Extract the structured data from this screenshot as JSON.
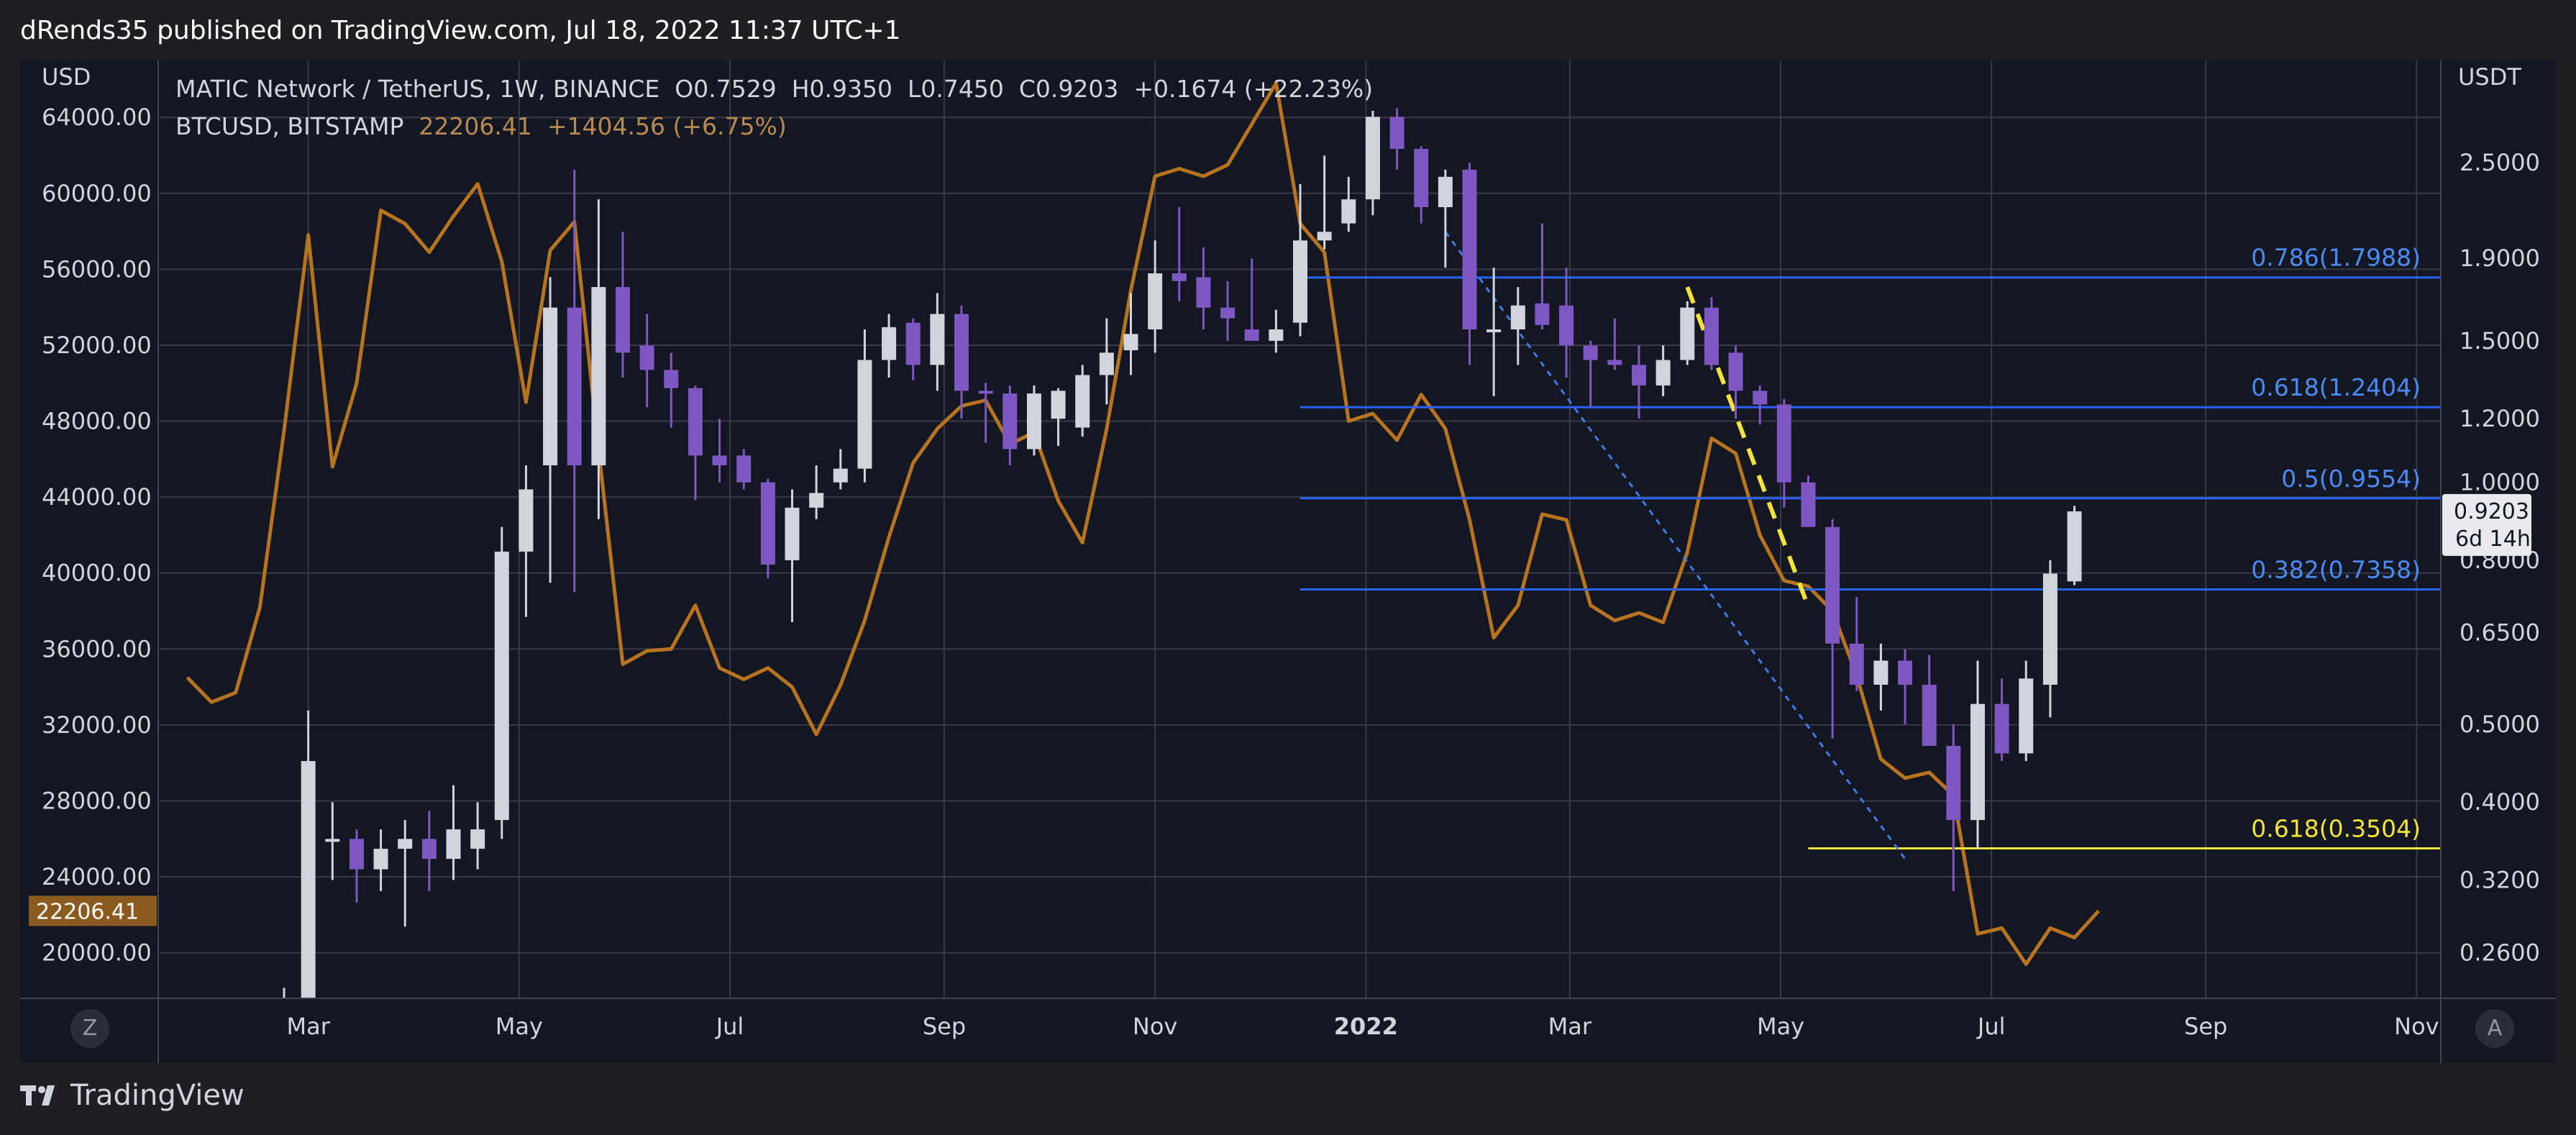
{
  "header": {
    "published_line": "dRends35 published on TradingView.com, Jul 18, 2022 11:37 UTC+1"
  },
  "footer": {
    "brand": "TradingView"
  },
  "buttons": {
    "left": "Z",
    "right": "A"
  },
  "colors": {
    "background": "#131722",
    "frame": "#1f1f23",
    "grid": "#363a45",
    "candle_up": "#d1d4dc",
    "candle_down": "#7e57c2",
    "btc_line": "#b8731f",
    "fib_blue": "#2962ff",
    "fib_blue_label": "#4c8bf5",
    "fib_yellow": "#f5e33b",
    "trend_blue": "#3d7be8",
    "trend_yellow": "#f5e33b"
  },
  "chart_data": {
    "type": "candlestick",
    "interval": "1W",
    "legend": {
      "main": {
        "name": "MATIC Network / TetherUS, 1W, BINANCE",
        "o_label": "O",
        "o": "0.7529",
        "h_label": "H",
        "h": "0.9350",
        "l_label": "L",
        "l": "0.7450",
        "c_label": "C",
        "c": "0.9203",
        "change": "+0.1674 (+22.23%)"
      },
      "overlay": {
        "name": "BTCUSD, BITSTAMP",
        "value": "22206.41",
        "change": "+1404.56 (+6.75%)"
      }
    },
    "left_axis": {
      "unit": "USD",
      "range": [
        17600,
        67000
      ],
      "ticks": [
        "64000.00",
        "60000.00",
        "56000.00",
        "52000.00",
        "48000.00",
        "44000.00",
        "40000.00",
        "36000.00",
        "32000.00",
        "28000.00",
        "24000.00",
        "20000.00"
      ],
      "current_label": "22206.41"
    },
    "right_axis": {
      "unit": "USDT",
      "scale": "log",
      "range": [
        0.228,
        3.35
      ],
      "ticks": [
        "2.5000",
        "1.9000",
        "1.5000",
        "1.2000",
        "1.0000",
        "0.8000",
        "0.6500",
        "0.5000",
        "0.4000",
        "0.3200",
        "0.2600"
      ],
      "current_price": "0.9203",
      "countdown": "6d 14h"
    },
    "x_axis": {
      "labels": [
        "Mar",
        "May",
        "Jul",
        "Sep",
        "Nov",
        "2022",
        "Mar",
        "May",
        "Jul",
        "Sep",
        "Nov"
      ],
      "bold": [
        false,
        false,
        false,
        false,
        false,
        true,
        false,
        false,
        false,
        false,
        false
      ]
    },
    "fib_levels": [
      {
        "label": "0.786(1.7988)",
        "value": 1.7988,
        "color": "blue",
        "start_date": "2021-12-13"
      },
      {
        "label": "0.618(1.2404)",
        "value": 1.2404,
        "color": "blue",
        "start_date": "2021-12-13"
      },
      {
        "label": "0.5(0.9554)",
        "value": 0.9554,
        "color": "blue",
        "start_date": "2021-12-13"
      },
      {
        "label": "0.382(0.7358)",
        "value": 0.7358,
        "color": "blue",
        "start_date": "2021-12-13"
      },
      {
        "label": "0.618(0.3504)",
        "value": 0.3504,
        "color": "yellow",
        "start_date": "2022-05-09"
      }
    ],
    "trendlines": [
      {
        "color": "blue",
        "style": "dotted",
        "start": [
          "2022-01-24",
          2.05
        ],
        "end": [
          "2022-06-06",
          0.34
        ]
      },
      {
        "color": "yellow",
        "style": "dashed",
        "start": [
          "2022-04-04",
          1.75
        ],
        "end": [
          "2022-05-09",
          0.7
        ]
      }
    ],
    "matic_candles": [
      {
        "date": "2021-02-22",
        "o": 0.2,
        "h": 0.235,
        "l": 0.18,
        "c": 0.2
      },
      {
        "date": "2021-03-01",
        "o": 0.22,
        "h": 0.52,
        "l": 0.2,
        "c": 0.45
      },
      {
        "date": "2021-03-08",
        "o": 0.36,
        "h": 0.4,
        "l": 0.32,
        "c": 0.36
      },
      {
        "date": "2021-03-15",
        "o": 0.36,
        "h": 0.37,
        "l": 0.3,
        "c": 0.33
      },
      {
        "date": "2021-03-22",
        "o": 0.33,
        "h": 0.37,
        "l": 0.31,
        "c": 0.35
      },
      {
        "date": "2021-03-29",
        "o": 0.35,
        "h": 0.38,
        "l": 0.28,
        "c": 0.36
      },
      {
        "date": "2021-04-05",
        "o": 0.36,
        "h": 0.39,
        "l": 0.31,
        "c": 0.34
      },
      {
        "date": "2021-04-12",
        "o": 0.34,
        "h": 0.42,
        "l": 0.32,
        "c": 0.37
      },
      {
        "date": "2021-04-19",
        "o": 0.35,
        "h": 0.4,
        "l": 0.33,
        "c": 0.37
      },
      {
        "date": "2021-04-26",
        "o": 0.38,
        "h": 0.88,
        "l": 0.36,
        "c": 0.82
      },
      {
        "date": "2021-05-03",
        "o": 0.82,
        "h": 1.05,
        "l": 0.68,
        "c": 0.98
      },
      {
        "date": "2021-05-10",
        "o": 1.05,
        "h": 1.8,
        "l": 0.75,
        "c": 1.65
      },
      {
        "date": "2021-05-17",
        "o": 1.65,
        "h": 2.45,
        "l": 0.73,
        "c": 1.05
      },
      {
        "date": "2021-05-24",
        "o": 1.05,
        "h": 2.25,
        "l": 0.9,
        "c": 1.75
      },
      {
        "date": "2021-05-31",
        "o": 1.75,
        "h": 2.05,
        "l": 1.35,
        "c": 1.45
      },
      {
        "date": "2021-06-07",
        "o": 1.48,
        "h": 1.62,
        "l": 1.24,
        "c": 1.38
      },
      {
        "date": "2021-06-14",
        "o": 1.38,
        "h": 1.45,
        "l": 1.17,
        "c": 1.31
      },
      {
        "date": "2021-06-21",
        "o": 1.31,
        "h": 1.32,
        "l": 0.95,
        "c": 1.08
      },
      {
        "date": "2021-06-28",
        "o": 1.08,
        "h": 1.2,
        "l": 1.0,
        "c": 1.05
      },
      {
        "date": "2021-07-05",
        "o": 1.08,
        "h": 1.1,
        "l": 0.98,
        "c": 1.0
      },
      {
        "date": "2021-07-12",
        "o": 1.0,
        "h": 1.01,
        "l": 0.76,
        "c": 0.79
      },
      {
        "date": "2021-07-19",
        "o": 0.8,
        "h": 0.98,
        "l": 0.67,
        "c": 0.93
      },
      {
        "date": "2021-07-26",
        "o": 0.93,
        "h": 1.05,
        "l": 0.9,
        "c": 0.97
      },
      {
        "date": "2021-08-02",
        "o": 1.0,
        "h": 1.1,
        "l": 0.98,
        "c": 1.04
      },
      {
        "date": "2021-08-09",
        "o": 1.04,
        "h": 1.55,
        "l": 1.0,
        "c": 1.42
      },
      {
        "date": "2021-08-16",
        "o": 1.42,
        "h": 1.62,
        "l": 1.35,
        "c": 1.56
      },
      {
        "date": "2021-08-23",
        "o": 1.58,
        "h": 1.6,
        "l": 1.34,
        "c": 1.4
      },
      {
        "date": "2021-08-30",
        "o": 1.4,
        "h": 1.72,
        "l": 1.3,
        "c": 1.62
      },
      {
        "date": "2021-09-06",
        "o": 1.62,
        "h": 1.66,
        "l": 1.2,
        "c": 1.3
      },
      {
        "date": "2021-09-13",
        "o": 1.3,
        "h": 1.33,
        "l": 1.12,
        "c": 1.29
      },
      {
        "date": "2021-09-20",
        "o": 1.29,
        "h": 1.32,
        "l": 1.05,
        "c": 1.1
      },
      {
        "date": "2021-09-27",
        "o": 1.1,
        "h": 1.32,
        "l": 1.08,
        "c": 1.29
      },
      {
        "date": "2021-10-04",
        "o": 1.2,
        "h": 1.31,
        "l": 1.11,
        "c": 1.3
      },
      {
        "date": "2021-10-11",
        "o": 1.17,
        "h": 1.4,
        "l": 1.14,
        "c": 1.36
      },
      {
        "date": "2021-10-18",
        "o": 1.36,
        "h": 1.6,
        "l": 1.25,
        "c": 1.45
      },
      {
        "date": "2021-10-25",
        "o": 1.46,
        "h": 1.72,
        "l": 1.36,
        "c": 1.53
      },
      {
        "date": "2021-11-01",
        "o": 1.55,
        "h": 2.0,
        "l": 1.45,
        "c": 1.82
      },
      {
        "date": "2021-11-08",
        "o": 1.82,
        "h": 2.2,
        "l": 1.68,
        "c": 1.78
      },
      {
        "date": "2021-11-15",
        "o": 1.8,
        "h": 1.96,
        "l": 1.55,
        "c": 1.65
      },
      {
        "date": "2021-11-22",
        "o": 1.65,
        "h": 1.78,
        "l": 1.5,
        "c": 1.6
      },
      {
        "date": "2021-11-29",
        "o": 1.55,
        "h": 1.9,
        "l": 1.55,
        "c": 1.5
      },
      {
        "date": "2021-12-06",
        "o": 1.5,
        "h": 1.64,
        "l": 1.45,
        "c": 1.55
      },
      {
        "date": "2021-12-13",
        "o": 1.58,
        "h": 2.35,
        "l": 1.52,
        "c": 2.0
      },
      {
        "date": "2021-12-20",
        "o": 2.0,
        "h": 2.55,
        "l": 1.95,
        "c": 2.05
      },
      {
        "date": "2021-12-27",
        "o": 2.1,
        "h": 2.4,
        "l": 2.05,
        "c": 2.25
      },
      {
        "date": "2022-01-03",
        "o": 2.25,
        "h": 2.9,
        "l": 2.15,
        "c": 2.85
      },
      {
        "date": "2022-01-10",
        "o": 2.85,
        "h": 2.92,
        "l": 2.45,
        "c": 2.6
      },
      {
        "date": "2022-01-17",
        "o": 2.6,
        "h": 2.62,
        "l": 2.1,
        "c": 2.2
      },
      {
        "date": "2022-01-24",
        "o": 2.2,
        "h": 2.45,
        "l": 1.85,
        "c": 2.4
      },
      {
        "date": "2022-01-31",
        "o": 2.45,
        "h": 2.5,
        "l": 1.4,
        "c": 1.55
      },
      {
        "date": "2022-02-07",
        "o": 1.55,
        "h": 1.85,
        "l": 1.28,
        "c": 1.55
      },
      {
        "date": "2022-02-14",
        "o": 1.55,
        "h": 1.75,
        "l": 1.4,
        "c": 1.66
      },
      {
        "date": "2022-02-21",
        "o": 1.67,
        "h": 2.1,
        "l": 1.55,
        "c": 1.57
      },
      {
        "date": "2022-02-28",
        "o": 1.66,
        "h": 1.85,
        "l": 1.35,
        "c": 1.48
      },
      {
        "date": "2022-03-07",
        "o": 1.48,
        "h": 1.5,
        "l": 1.24,
        "c": 1.42
      },
      {
        "date": "2022-03-14",
        "o": 1.42,
        "h": 1.6,
        "l": 1.38,
        "c": 1.4
      },
      {
        "date": "2022-03-21",
        "o": 1.4,
        "h": 1.48,
        "l": 1.2,
        "c": 1.32
      },
      {
        "date": "2022-03-28",
        "o": 1.32,
        "h": 1.48,
        "l": 1.28,
        "c": 1.42
      },
      {
        "date": "2022-04-04",
        "o": 1.42,
        "h": 1.68,
        "l": 1.4,
        "c": 1.65
      },
      {
        "date": "2022-04-11",
        "o": 1.65,
        "h": 1.7,
        "l": 1.38,
        "c": 1.4
      },
      {
        "date": "2022-04-18",
        "o": 1.45,
        "h": 1.48,
        "l": 1.2,
        "c": 1.3
      },
      {
        "date": "2022-04-25",
        "o": 1.3,
        "h": 1.32,
        "l": 1.18,
        "c": 1.25
      },
      {
        "date": "2022-05-02",
        "o": 1.25,
        "h": 1.27,
        "l": 0.93,
        "c": 1.0
      },
      {
        "date": "2022-05-09",
        "o": 1.0,
        "h": 1.02,
        "l": 0.9,
        "c": 0.88
      },
      {
        "date": "2022-05-16",
        "o": 0.88,
        "h": 0.9,
        "l": 0.48,
        "c": 0.63
      },
      {
        "date": "2022-05-23",
        "o": 0.63,
        "h": 0.72,
        "l": 0.55,
        "c": 0.56
      },
      {
        "date": "2022-05-30",
        "o": 0.56,
        "h": 0.63,
        "l": 0.52,
        "c": 0.6
      },
      {
        "date": "2022-06-06",
        "o": 0.6,
        "h": 0.62,
        "l": 0.5,
        "c": 0.56
      },
      {
        "date": "2022-06-13",
        "o": 0.56,
        "h": 0.61,
        "l": 0.47,
        "c": 0.47
      },
      {
        "date": "2022-06-20",
        "o": 0.47,
        "h": 0.5,
        "l": 0.31,
        "c": 0.38
      },
      {
        "date": "2022-06-27",
        "o": 0.38,
        "h": 0.6,
        "l": 0.35,
        "c": 0.53
      },
      {
        "date": "2022-07-04",
        "o": 0.53,
        "h": 0.57,
        "l": 0.45,
        "c": 0.46
      },
      {
        "date": "2022-07-11",
        "o": 0.46,
        "h": 0.6,
        "l": 0.45,
        "c": 0.57
      },
      {
        "date": "2022-07-18",
        "o": 0.56,
        "h": 0.8,
        "l": 0.51,
        "c": 0.77
      },
      {
        "date": "2022-07-25",
        "o": 0.7529,
        "h": 0.935,
        "l": 0.745,
        "c": 0.9203
      }
    ],
    "btc_series": [
      {
        "date": "2021-01-25",
        "v": 34500
      },
      {
        "date": "2021-02-01",
        "v": 33200
      },
      {
        "date": "2021-02-08",
        "v": 33700
      },
      {
        "date": "2021-02-15",
        "v": 38200
      },
      {
        "date": "2021-02-22",
        "v": 47500
      },
      {
        "date": "2021-03-01",
        "v": 57800
      },
      {
        "date": "2021-03-08",
        "v": 45600
      },
      {
        "date": "2021-03-15",
        "v": 50000
      },
      {
        "date": "2021-03-22",
        "v": 59100
      },
      {
        "date": "2021-03-29",
        "v": 58400
      },
      {
        "date": "2021-04-05",
        "v": 56900
      },
      {
        "date": "2021-04-12",
        "v": 58800
      },
      {
        "date": "2021-04-19",
        "v": 60500
      },
      {
        "date": "2021-04-26",
        "v": 56400
      },
      {
        "date": "2021-05-03",
        "v": 49000
      },
      {
        "date": "2021-05-10",
        "v": 57000
      },
      {
        "date": "2021-05-17",
        "v": 58500
      },
      {
        "date": "2021-05-24",
        "v": 46500
      },
      {
        "date": "2021-05-31",
        "v": 35200
      },
      {
        "date": "2021-06-07",
        "v": 35900
      },
      {
        "date": "2021-06-14",
        "v": 36000
      },
      {
        "date": "2021-06-21",
        "v": 38300
      },
      {
        "date": "2021-06-28",
        "v": 35000
      },
      {
        "date": "2021-07-05",
        "v": 34400
      },
      {
        "date": "2021-07-12",
        "v": 35000
      },
      {
        "date": "2021-07-19",
        "v": 34000
      },
      {
        "date": "2021-07-26",
        "v": 31500
      },
      {
        "date": "2021-08-02",
        "v": 34100
      },
      {
        "date": "2021-08-09",
        "v": 37500
      },
      {
        "date": "2021-08-16",
        "v": 41900
      },
      {
        "date": "2021-08-23",
        "v": 45800
      },
      {
        "date": "2021-08-30",
        "v": 47600
      },
      {
        "date": "2021-09-06",
        "v": 48800
      },
      {
        "date": "2021-09-13",
        "v": 49100
      },
      {
        "date": "2021-09-20",
        "v": 46800
      },
      {
        "date": "2021-09-27",
        "v": 47400
      },
      {
        "date": "2021-10-04",
        "v": 43800
      },
      {
        "date": "2021-10-11",
        "v": 41600
      },
      {
        "date": "2021-10-18",
        "v": 47600
      },
      {
        "date": "2021-10-25",
        "v": 54900
      },
      {
        "date": "2021-11-01",
        "v": 60900
      },
      {
        "date": "2021-11-08",
        "v": 61300
      },
      {
        "date": "2021-11-15",
        "v": 60900
      },
      {
        "date": "2021-11-22",
        "v": 61500
      },
      {
        "date": "2021-12-06",
        "v": 65800
      },
      {
        "date": "2021-12-13",
        "v": 58400
      },
      {
        "date": "2021-12-20",
        "v": 56900
      },
      {
        "date": "2021-12-27",
        "v": 48000
      },
      {
        "date": "2022-01-03",
        "v": 48400
      },
      {
        "date": "2022-01-10",
        "v": 47000
      },
      {
        "date": "2022-01-17",
        "v": 49400
      },
      {
        "date": "2022-01-24",
        "v": 47600
      },
      {
        "date": "2022-01-31",
        "v": 42800
      },
      {
        "date": "2022-02-07",
        "v": 36600
      },
      {
        "date": "2022-02-14",
        "v": 38300
      },
      {
        "date": "2022-02-21",
        "v": 43100
      },
      {
        "date": "2022-02-28",
        "v": 42800
      },
      {
        "date": "2022-03-07",
        "v": 38300
      },
      {
        "date": "2022-03-14",
        "v": 37500
      },
      {
        "date": "2022-03-21",
        "v": 37900
      },
      {
        "date": "2022-03-28",
        "v": 37400
      },
      {
        "date": "2022-04-04",
        "v": 41100
      },
      {
        "date": "2022-04-11",
        "v": 47100
      },
      {
        "date": "2022-04-18",
        "v": 46300
      },
      {
        "date": "2022-04-25",
        "v": 42000
      },
      {
        "date": "2022-05-02",
        "v": 39600
      },
      {
        "date": "2022-05-09",
        "v": 39300
      },
      {
        "date": "2022-05-16",
        "v": 38000
      },
      {
        "date": "2022-05-23",
        "v": 34600
      },
      {
        "date": "2022-05-30",
        "v": 30200
      },
      {
        "date": "2022-06-06",
        "v": 29200
      },
      {
        "date": "2022-06-13",
        "v": 29500
      },
      {
        "date": "2022-06-20",
        "v": 28300
      },
      {
        "date": "2022-06-27",
        "v": 21000
      },
      {
        "date": "2022-07-04",
        "v": 21300
      },
      {
        "date": "2022-07-11",
        "v": 19400
      },
      {
        "date": "2022-07-18",
        "v": 21300
      },
      {
        "date": "2022-07-25",
        "v": 20800
      },
      {
        "date": "2022-08-01",
        "v": 22206.41
      }
    ]
  }
}
